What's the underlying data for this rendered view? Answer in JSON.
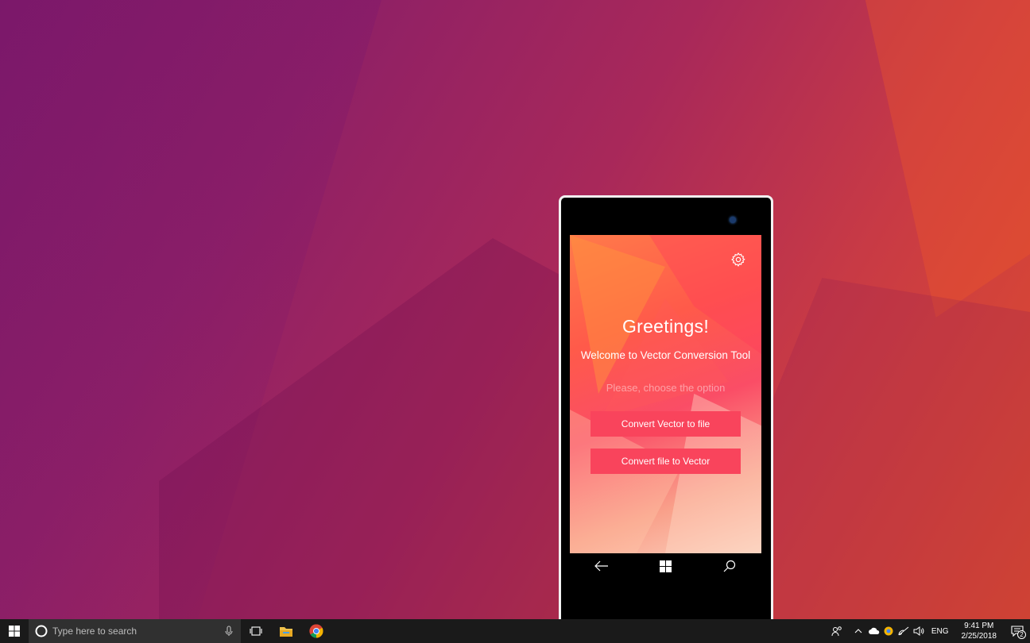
{
  "app": {
    "greeting": "Greetings!",
    "welcome": "Welcome to Vector Conversion Tool",
    "prompt": "Please, choose the option",
    "buttons": {
      "vector_to_file": "Convert Vector to file",
      "file_to_vector": "Convert file to Vector"
    },
    "accent_color": "#f9445c"
  },
  "phone_nav": {
    "icons": [
      "back-arrow-icon",
      "windows-logo-icon",
      "search-icon"
    ]
  },
  "taskbar": {
    "search_placeholder": "Type here to search",
    "language": "ENG",
    "time": "9:41 PM",
    "date": "2/25/2018",
    "notification_count": "2",
    "pinned_icons": [
      "task-view-icon",
      "file-explorer-icon",
      "chrome-icon"
    ],
    "tray_icons": [
      "people-icon",
      "chevron-up-icon",
      "onedrive-icon",
      "chrome-tray-icon",
      "wifi-icon",
      "volume-icon"
    ]
  }
}
